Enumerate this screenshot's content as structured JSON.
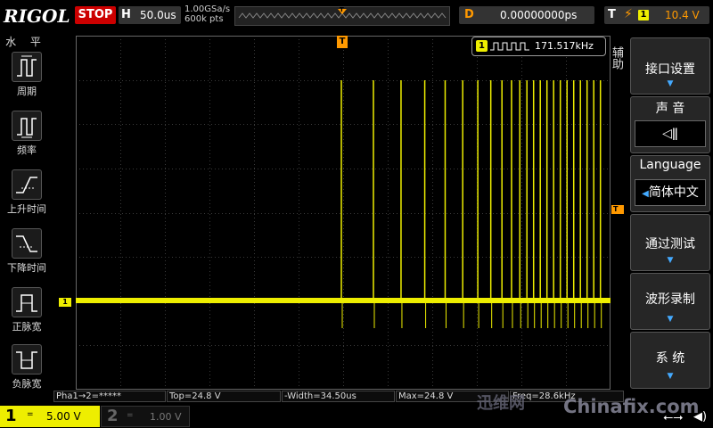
{
  "header": {
    "logo": "RIGOL",
    "run_state": "STOP",
    "timebase_label": "H",
    "timebase_value": "50.0us",
    "sample_rate": "1.00GSa/s",
    "memory_depth": "600k pts",
    "trigger_marker": "T",
    "delay_label": "D",
    "delay_value": "0.00000000ps",
    "trigger_label": "T",
    "trigger_channel": "1",
    "trigger_level": "10.4 V"
  },
  "left_menu": {
    "title": "水 平",
    "items": [
      {
        "label": "周期",
        "icon": "period-icon"
      },
      {
        "label": "频率",
        "icon": "frequency-icon"
      },
      {
        "label": "上升时间",
        "icon": "rise-time-icon"
      },
      {
        "label": "下降时间",
        "icon": "fall-time-icon"
      },
      {
        "label": "正脉宽",
        "icon": "positive-width-icon"
      },
      {
        "label": "负脉宽",
        "icon": "negative-width-icon"
      }
    ]
  },
  "right_menu": {
    "side_title": "辅助",
    "buttons": [
      {
        "label": "接口设置",
        "has_arrow": true
      },
      {
        "label": "声 音",
        "value_icon": "speaker-mute-icon"
      },
      {
        "label": "Language",
        "value": "简体中文"
      },
      {
        "label": "通过测试",
        "has_arrow": true
      },
      {
        "label": "波形录制",
        "has_arrow": true
      },
      {
        "label": "系 统",
        "has_arrow": true
      }
    ]
  },
  "frequency_counter": {
    "channel": "1",
    "value": "171.517kHz"
  },
  "waveform": {
    "channel_marker": "1",
    "trigger_marker": "T",
    "color": "#eeee00"
  },
  "measurements": {
    "phase": "Pha1→2=*****",
    "top": "Top=24.8 V",
    "neg_width": "-Width=34.50us",
    "max": "Max=24.8 V",
    "freq": "Freq=28.6kHz"
  },
  "channels": {
    "ch1": {
      "number": "1",
      "coupling": "=",
      "scale": "5.00 V",
      "color": "#eeee00"
    },
    "ch2": {
      "number": "2",
      "coupling": "=",
      "scale": "1.00 V"
    }
  },
  "watermark": {
    "cn": "迅维网",
    "en": "Chinafix.com"
  }
}
